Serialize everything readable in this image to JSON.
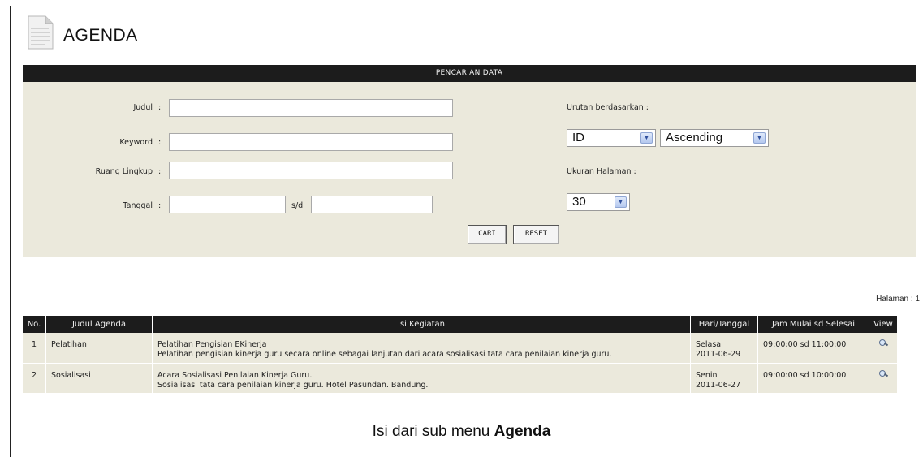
{
  "title": "AGENDA",
  "search": {
    "header": "PENCARIAN DATA",
    "fields": {
      "judul_label": "Judul",
      "keyword_label": "Keyword",
      "ruang_lingkup_label": "Ruang Lingkup",
      "tanggal_label": "Tanggal",
      "colon": ":",
      "sd_label": "s/d",
      "judul_value": "",
      "keyword_value": "",
      "ruang_lingkup_value": "",
      "tanggal_from_value": "",
      "tanggal_to_value": ""
    },
    "sort": {
      "label": "Urutan berdasarkan :",
      "field_selected": "ID",
      "order_selected": "Ascending"
    },
    "page_size": {
      "label": "Ukuran Halaman :",
      "selected": "30"
    },
    "buttons": {
      "cari": "CARI",
      "reset": "RESET"
    }
  },
  "halaman": "Halaman : 1",
  "table": {
    "headers": [
      "No.",
      "Judul Agenda",
      "Isi Kegiatan",
      "Hari/Tanggal",
      "Jam Mulai sd Selesai",
      "View"
    ],
    "rows": [
      {
        "no": "1",
        "judul": "Pelatihan",
        "isi_title": "Pelatihan Pengisian EKinerja",
        "isi_desc": "Pelatihan pengisian kinerja guru secara online sebagai lanjutan dari acara sosialisasi tata cara penilaian kinerja guru.",
        "hari": "Selasa",
        "tanggal": "2011-06-29",
        "jam": "09:00:00 sd 11:00:00",
        "view_icon": "magnifier-icon"
      },
      {
        "no": "2",
        "judul": "Sosialisasi",
        "isi_title": "Acara Sosialisasi Penilaian Kinerja Guru.",
        "isi_desc": "Sosialisasi tata cara penilaian kinerja guru. Hotel Pasundan. Bandung.",
        "hari": "Senin",
        "tanggal": "2011-06-27",
        "jam": "09:00:00 sd 10:00:00",
        "view_icon": "magnifier-icon"
      }
    ]
  },
  "caption": {
    "prefix": "Isi dari sub menu ",
    "bold": "Agenda"
  },
  "colors": {
    "header_bg": "#1c1c1c",
    "panel_bg": "#ebe9dc"
  }
}
